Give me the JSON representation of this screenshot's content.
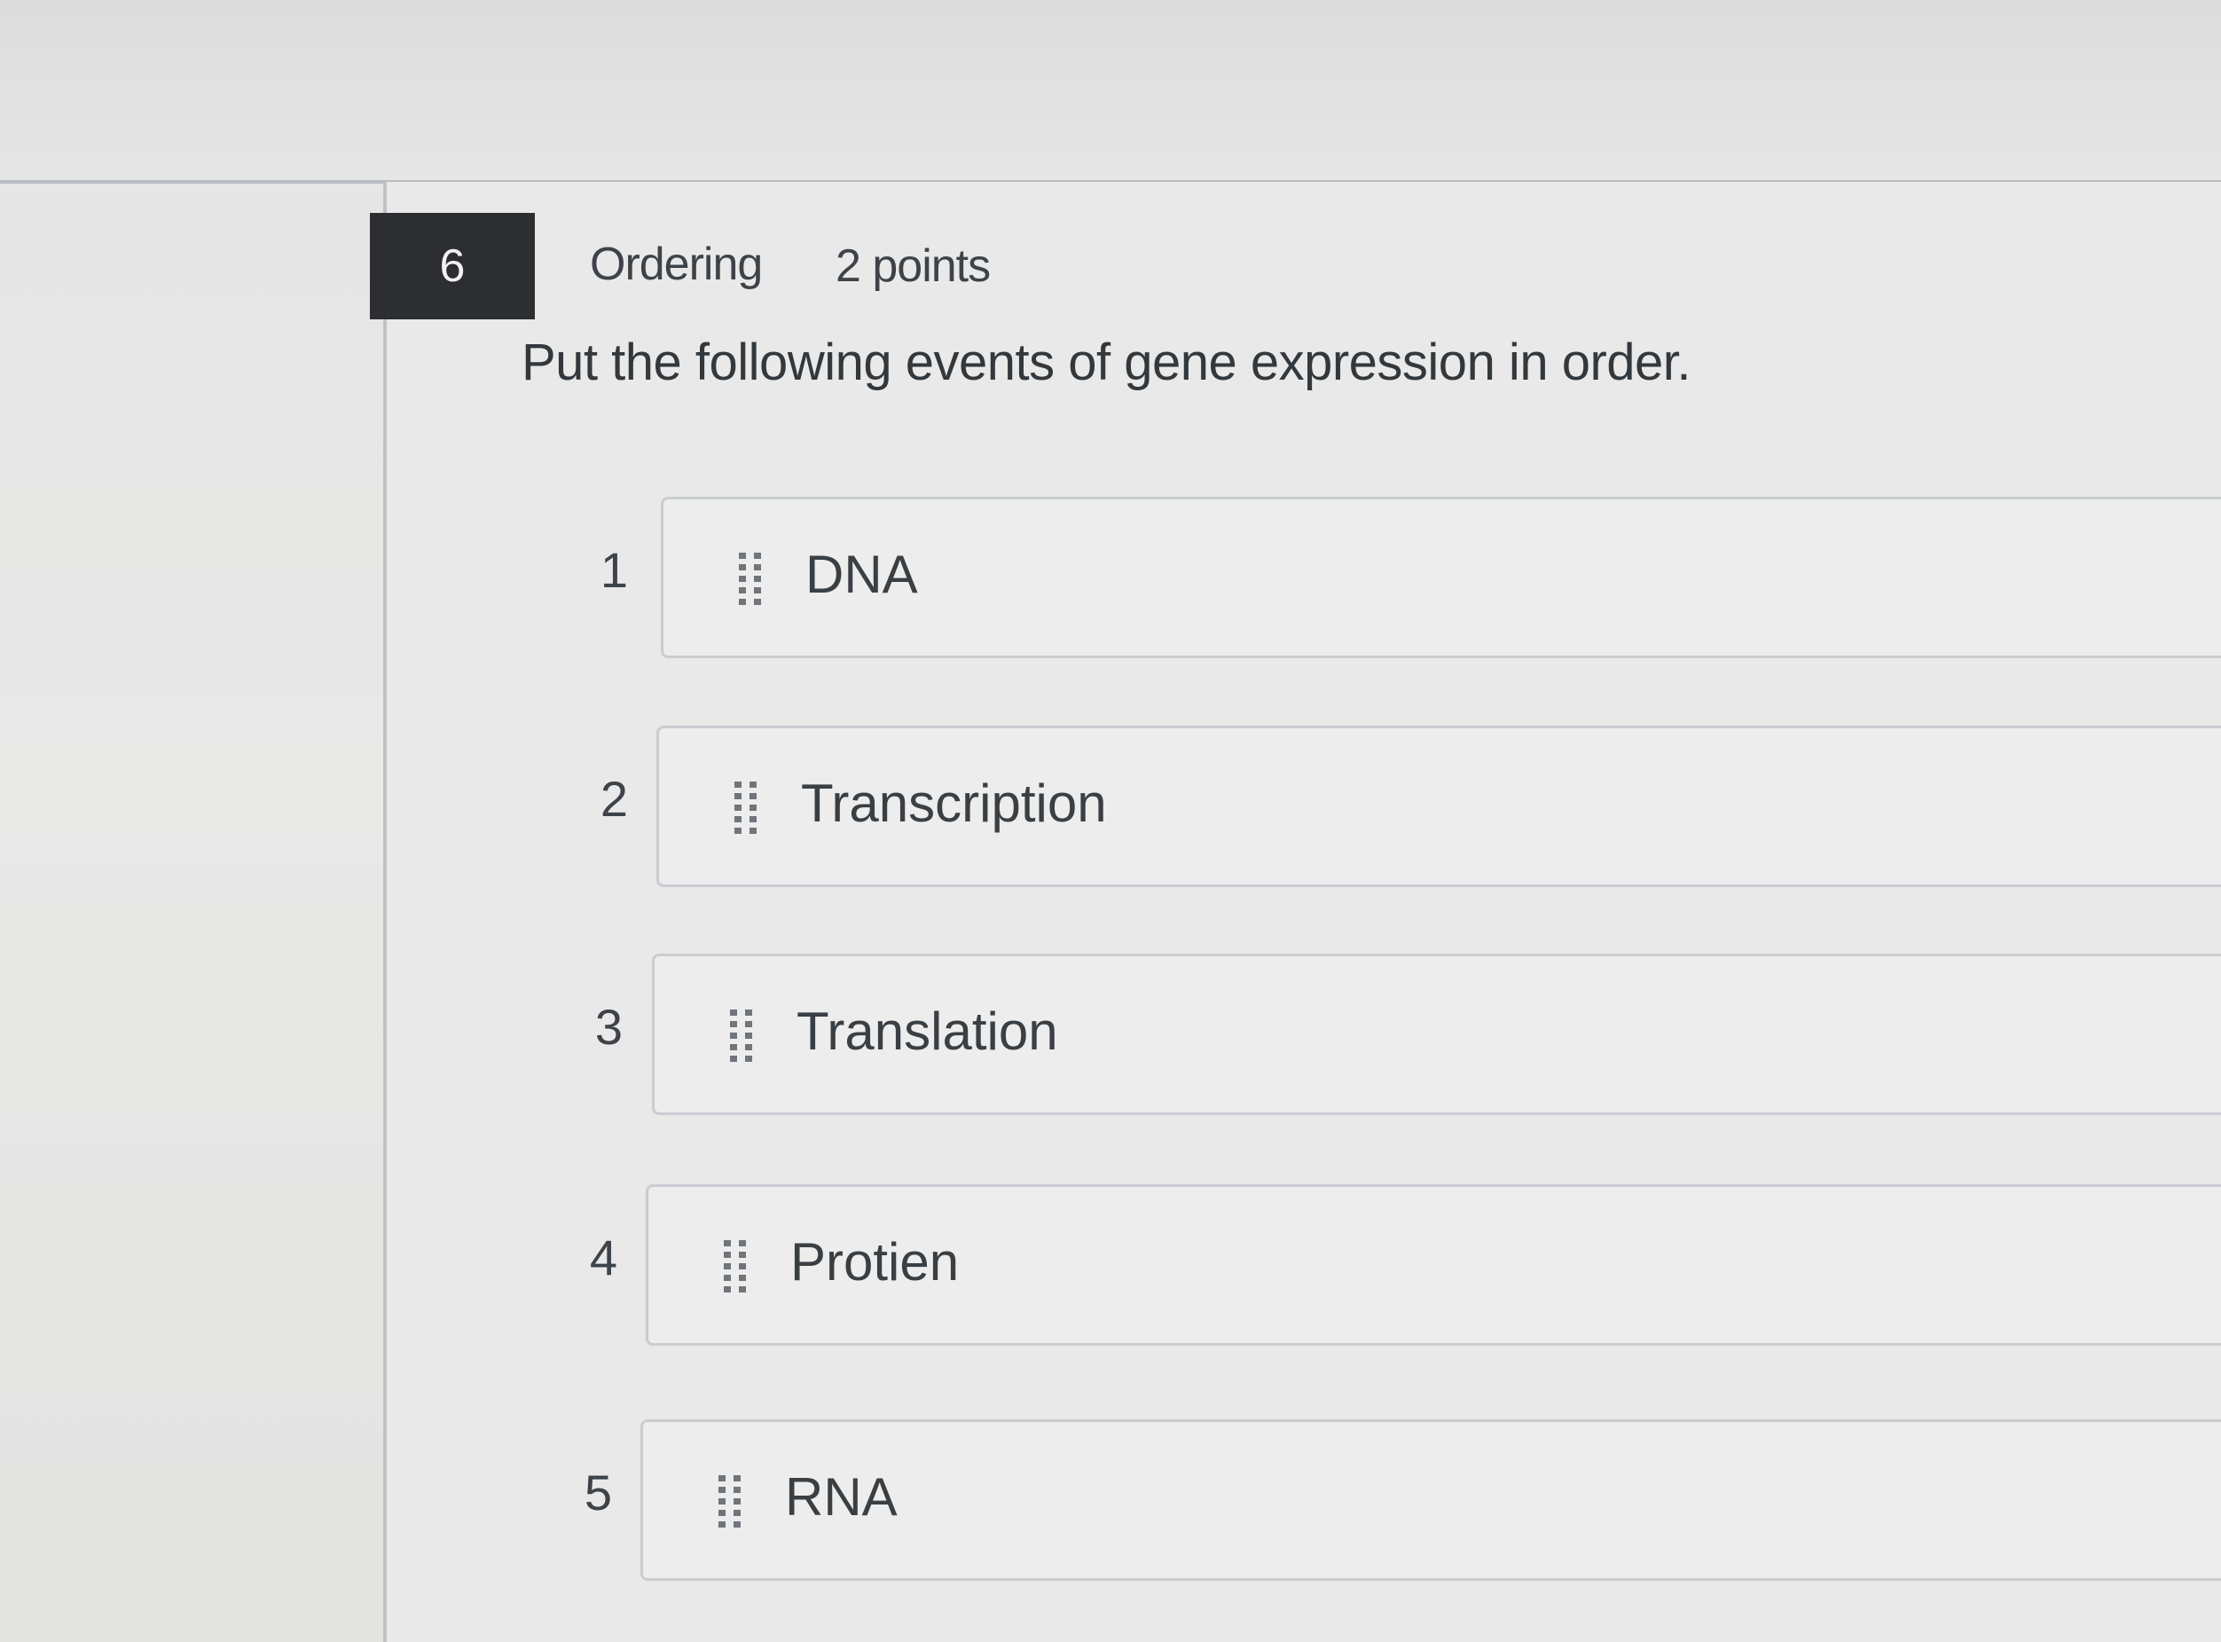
{
  "question": {
    "number": "6",
    "type": "Ordering",
    "points": "2 points",
    "prompt": "Put the following events of gene expression in order."
  },
  "items": [
    {
      "position": "1",
      "label": "DNA"
    },
    {
      "position": "2",
      "label": "Transcription"
    },
    {
      "position": "3",
      "label": "Translation"
    },
    {
      "position": "4",
      "label": "Protien"
    },
    {
      "position": "5",
      "label": "RNA"
    }
  ],
  "icons": {
    "drag_handle": "drag-handle-icon"
  },
  "colors": {
    "number_badge_bg": "#2c2e31",
    "number_badge_text": "#f2f2f2",
    "background": "#e6e6e6",
    "border": "#c9cdd1",
    "text": "#3b4045"
  }
}
